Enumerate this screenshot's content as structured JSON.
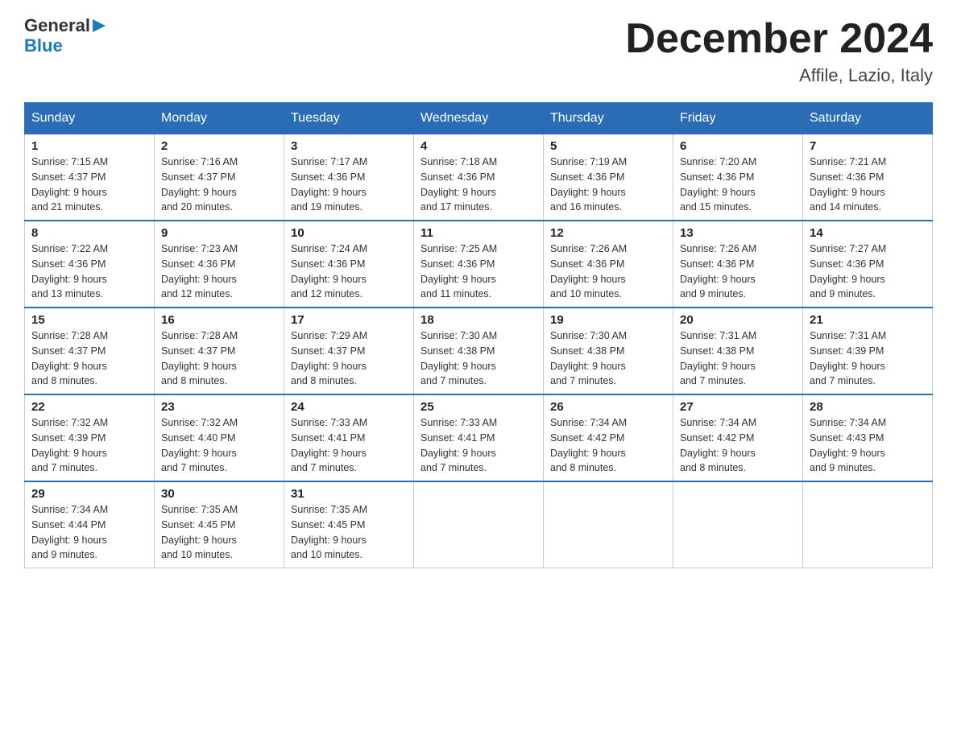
{
  "header": {
    "logo_general": "General",
    "logo_blue": "Blue",
    "month_title": "December 2024",
    "location": "Affile, Lazio, Italy"
  },
  "days_of_week": [
    "Sunday",
    "Monday",
    "Tuesday",
    "Wednesday",
    "Thursday",
    "Friday",
    "Saturday"
  ],
  "weeks": [
    [
      {
        "day": "1",
        "sunrise": "7:15 AM",
        "sunset": "4:37 PM",
        "daylight": "9 hours and 21 minutes."
      },
      {
        "day": "2",
        "sunrise": "7:16 AM",
        "sunset": "4:37 PM",
        "daylight": "9 hours and 20 minutes."
      },
      {
        "day": "3",
        "sunrise": "7:17 AM",
        "sunset": "4:36 PM",
        "daylight": "9 hours and 19 minutes."
      },
      {
        "day": "4",
        "sunrise": "7:18 AM",
        "sunset": "4:36 PM",
        "daylight": "9 hours and 17 minutes."
      },
      {
        "day": "5",
        "sunrise": "7:19 AM",
        "sunset": "4:36 PM",
        "daylight": "9 hours and 16 minutes."
      },
      {
        "day": "6",
        "sunrise": "7:20 AM",
        "sunset": "4:36 PM",
        "daylight": "9 hours and 15 minutes."
      },
      {
        "day": "7",
        "sunrise": "7:21 AM",
        "sunset": "4:36 PM",
        "daylight": "9 hours and 14 minutes."
      }
    ],
    [
      {
        "day": "8",
        "sunrise": "7:22 AM",
        "sunset": "4:36 PM",
        "daylight": "9 hours and 13 minutes."
      },
      {
        "day": "9",
        "sunrise": "7:23 AM",
        "sunset": "4:36 PM",
        "daylight": "9 hours and 12 minutes."
      },
      {
        "day": "10",
        "sunrise": "7:24 AM",
        "sunset": "4:36 PM",
        "daylight": "9 hours and 12 minutes."
      },
      {
        "day": "11",
        "sunrise": "7:25 AM",
        "sunset": "4:36 PM",
        "daylight": "9 hours and 11 minutes."
      },
      {
        "day": "12",
        "sunrise": "7:26 AM",
        "sunset": "4:36 PM",
        "daylight": "9 hours and 10 minutes."
      },
      {
        "day": "13",
        "sunrise": "7:26 AM",
        "sunset": "4:36 PM",
        "daylight": "9 hours and 9 minutes."
      },
      {
        "day": "14",
        "sunrise": "7:27 AM",
        "sunset": "4:36 PM",
        "daylight": "9 hours and 9 minutes."
      }
    ],
    [
      {
        "day": "15",
        "sunrise": "7:28 AM",
        "sunset": "4:37 PM",
        "daylight": "9 hours and 8 minutes."
      },
      {
        "day": "16",
        "sunrise": "7:28 AM",
        "sunset": "4:37 PM",
        "daylight": "9 hours and 8 minutes."
      },
      {
        "day": "17",
        "sunrise": "7:29 AM",
        "sunset": "4:37 PM",
        "daylight": "9 hours and 8 minutes."
      },
      {
        "day": "18",
        "sunrise": "7:30 AM",
        "sunset": "4:38 PM",
        "daylight": "9 hours and 7 minutes."
      },
      {
        "day": "19",
        "sunrise": "7:30 AM",
        "sunset": "4:38 PM",
        "daylight": "9 hours and 7 minutes."
      },
      {
        "day": "20",
        "sunrise": "7:31 AM",
        "sunset": "4:38 PM",
        "daylight": "9 hours and 7 minutes."
      },
      {
        "day": "21",
        "sunrise": "7:31 AM",
        "sunset": "4:39 PM",
        "daylight": "9 hours and 7 minutes."
      }
    ],
    [
      {
        "day": "22",
        "sunrise": "7:32 AM",
        "sunset": "4:39 PM",
        "daylight": "9 hours and 7 minutes."
      },
      {
        "day": "23",
        "sunrise": "7:32 AM",
        "sunset": "4:40 PM",
        "daylight": "9 hours and 7 minutes."
      },
      {
        "day": "24",
        "sunrise": "7:33 AM",
        "sunset": "4:41 PM",
        "daylight": "9 hours and 7 minutes."
      },
      {
        "day": "25",
        "sunrise": "7:33 AM",
        "sunset": "4:41 PM",
        "daylight": "9 hours and 7 minutes."
      },
      {
        "day": "26",
        "sunrise": "7:34 AM",
        "sunset": "4:42 PM",
        "daylight": "9 hours and 8 minutes."
      },
      {
        "day": "27",
        "sunrise": "7:34 AM",
        "sunset": "4:42 PM",
        "daylight": "9 hours and 8 minutes."
      },
      {
        "day": "28",
        "sunrise": "7:34 AM",
        "sunset": "4:43 PM",
        "daylight": "9 hours and 9 minutes."
      }
    ],
    [
      {
        "day": "29",
        "sunrise": "7:34 AM",
        "sunset": "4:44 PM",
        "daylight": "9 hours and 9 minutes."
      },
      {
        "day": "30",
        "sunrise": "7:35 AM",
        "sunset": "4:45 PM",
        "daylight": "9 hours and 10 minutes."
      },
      {
        "day": "31",
        "sunrise": "7:35 AM",
        "sunset": "4:45 PM",
        "daylight": "9 hours and 10 minutes."
      },
      null,
      null,
      null,
      null
    ]
  ],
  "labels": {
    "sunrise": "Sunrise:",
    "sunset": "Sunset:",
    "daylight": "Daylight:"
  }
}
